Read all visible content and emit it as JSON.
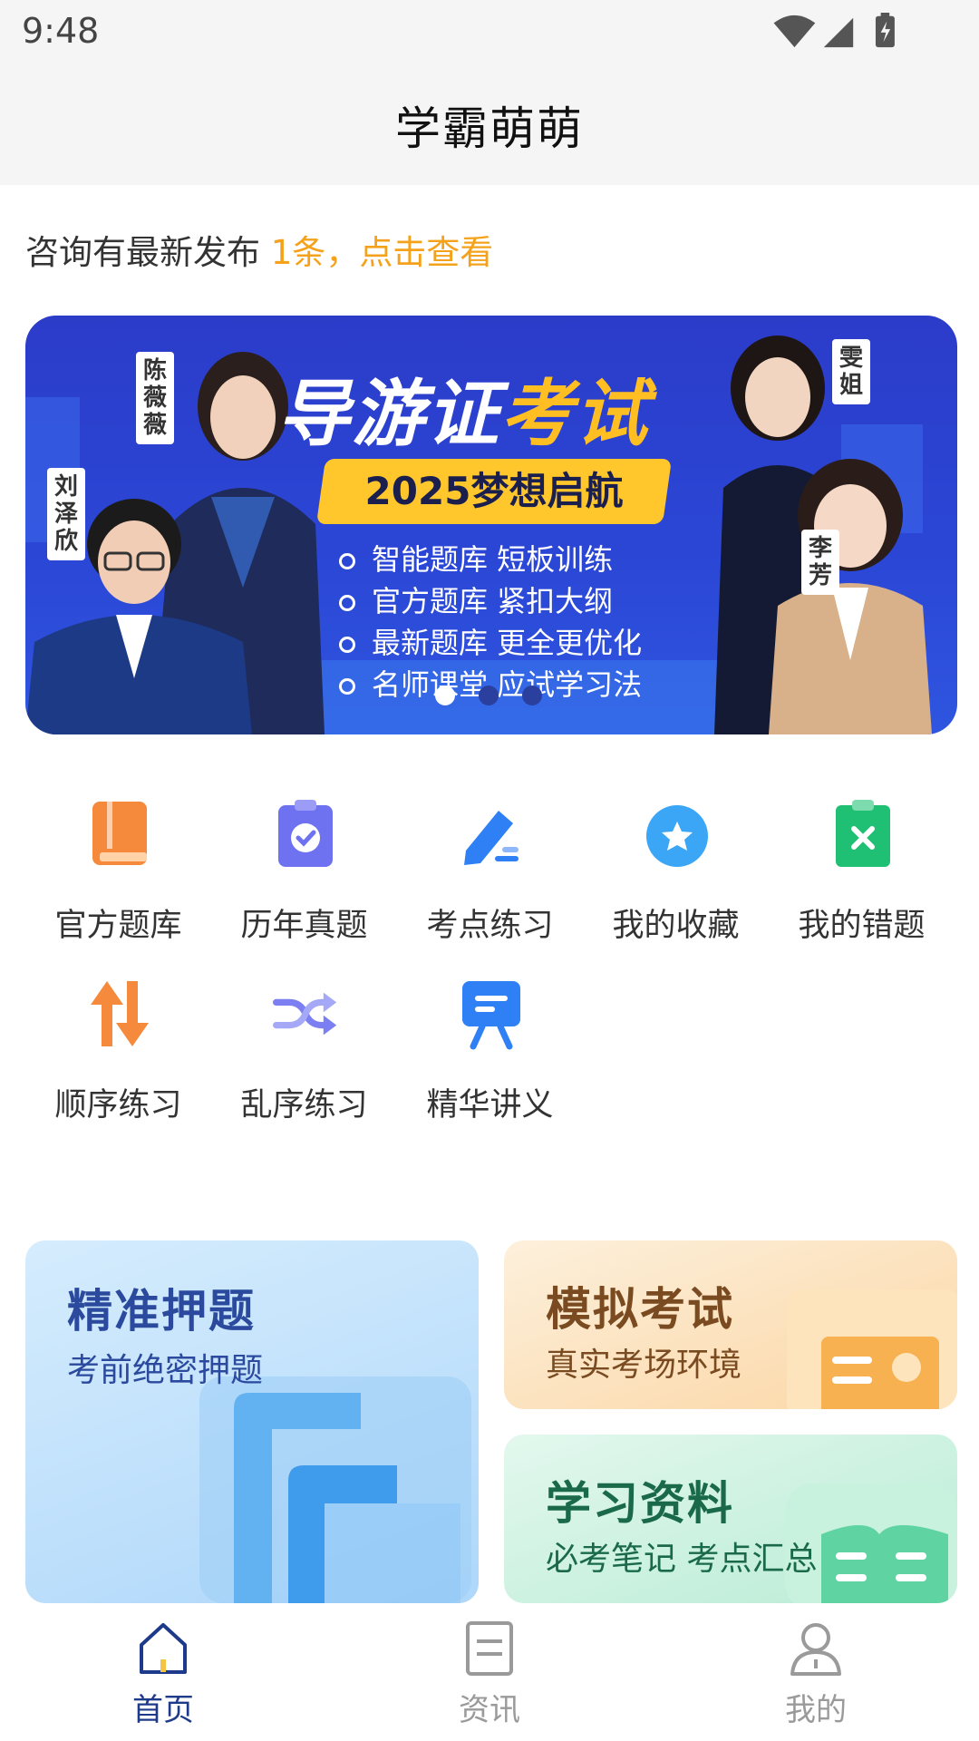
{
  "status_bar": {
    "time": "9:48"
  },
  "header": {
    "title": "学霸萌萌"
  },
  "notice": {
    "prefix": "咨询有最新发布 ",
    "count": "1条",
    "sep": "，",
    "action": "点击查看"
  },
  "banner": {
    "title_white": "导游证",
    "title_yellow": "考试",
    "slogan": "2025梦想启航",
    "features": [
      "智能题库  短板训练",
      "官方题库  紧扣大纲",
      "最新题库  更全更优化",
      "名师课堂  应试学习法"
    ],
    "teachers": [
      "陈薇薇",
      "刘泽欣",
      "雯姐",
      "李芳"
    ],
    "slides_total": 3,
    "slide_active": 1
  },
  "grid": [
    {
      "label": "官方题库",
      "icon": "book-icon",
      "color": "#f58a3c"
    },
    {
      "label": "历年真题",
      "icon": "clipboard-check-icon",
      "color": "#6f72f0"
    },
    {
      "label": "考点练习",
      "icon": "pen-edit-icon",
      "color": "#2f7ff5"
    },
    {
      "label": "我的收藏",
      "icon": "star-icon",
      "color": "#3aa6f5"
    },
    {
      "label": "我的错题",
      "icon": "clipboard-x-icon",
      "color": "#1fbf74"
    },
    {
      "label": "顺序练习",
      "icon": "sort-arrows-icon",
      "color": "#f58a3c"
    },
    {
      "label": "乱序练习",
      "icon": "shuffle-icon",
      "color": "#7b7ff2"
    },
    {
      "label": "精华讲义",
      "icon": "lecture-icon",
      "color": "#2f7ff5"
    }
  ],
  "cards": {
    "predict": {
      "title": "精准押题",
      "subtitle": "考前绝密押题",
      "color": "#2b4a9e"
    },
    "mock": {
      "title": "模拟考试",
      "subtitle": "真实考场环境",
      "color": "#7a4a20"
    },
    "materials": {
      "title": "学习资料",
      "subtitle": "必考笔记 考点汇总",
      "color": "#1a6a4a"
    }
  },
  "tabbar": {
    "items": [
      {
        "label": "首页",
        "icon": "home-icon"
      },
      {
        "label": "资讯",
        "icon": "news-icon"
      },
      {
        "label": "我的",
        "icon": "profile-icon"
      }
    ],
    "active": 0,
    "active_color": "#1e3a8a",
    "inactive_color": "#9a9a9a"
  }
}
